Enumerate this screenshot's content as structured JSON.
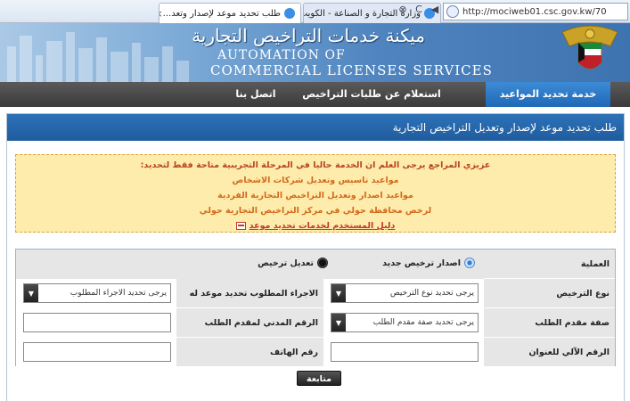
{
  "browser": {
    "url": "http://mociweb01.csc.gov.kw/70",
    "tabs": [
      {
        "title": "وزارة التجارة و الصناعة - الكويت"
      },
      {
        "title": "طلب تحديد موعد لإصدار وتعد..."
      }
    ],
    "close_glyph": "×"
  },
  "header": {
    "title_ar": "ميكنة خدمات التراخيص التجارية",
    "title_en_line1": "AUTOMATION OF",
    "title_en_line2": "COMMERCIAL LICENSES SERVICES"
  },
  "menu": {
    "items": [
      {
        "label": "خدمة تحديد المواعيد",
        "active": true
      },
      {
        "label": "استعلام عن طلبات التراخيص التجارية",
        "active": false
      },
      {
        "label": "اتصل بنا",
        "active": false
      }
    ]
  },
  "page": {
    "title": "طلب تحديد موعد لإصدار وتعديل التراخيص التجارية"
  },
  "notice": {
    "main": "عزيزي المراجع يرجى العلم ان الخدمة حاليا في المرحلة التجريبية متاحة فقط لتحديد:",
    "lines": [
      "مواعيد تاسيس وتعديل شركات الاشخاص",
      "مواعيد اصدار وتعديل التراخيص التجارية الفردية",
      "لرخص محافظة حولي في مركز التراخيص التجارية حولي"
    ],
    "guide_link": "دليل المستخدم لخدمات تحديد موعد"
  },
  "form": {
    "operation_label": "العملية",
    "operation_options": [
      {
        "label": "اصدار ترخيص جديد",
        "selected": true
      },
      {
        "label": "تعديل ترخيص",
        "selected": false
      }
    ],
    "license_type_label": "نوع الترخيص",
    "license_type_placeholder": "يرجى تحديد نوع الترخيص",
    "action_label": "الاجراء المطلوب تحديد موعد له",
    "action_placeholder": "يرجى تحديد الاجراء المطلوب",
    "applicant_type_label": "صفة مقدم الطلب",
    "applicant_type_placeholder": "يرجى تحديد صفة مقدم الطلب",
    "civil_id_label": "الرقم المدني لمقدم الطلب",
    "civil_id_value": "",
    "address_no_label": "الرقم الآلي للعنوان",
    "address_no_value": "",
    "phone_label": "رقم الهاتف",
    "phone_value": "",
    "submit_label": "متابعة"
  },
  "icons": {
    "dropdown_arrow": "▼",
    "nav_back": "◀",
    "nav_refresh": "C",
    "nav_stop": "⊗"
  }
}
